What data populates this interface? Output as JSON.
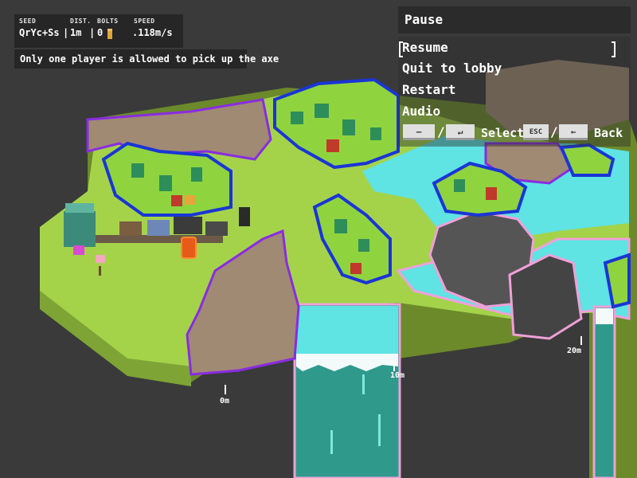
{
  "hud": {
    "seed_caption": "SEED",
    "seed_value": "QrYc+Ss",
    "dist_caption": "DIST.",
    "dist_value": "1m",
    "bolts_caption": "BOLTS",
    "bolts_value": "0",
    "speed_caption": "SPEED",
    "speed_value": ".118m/s"
  },
  "notice": "Only one player is allowed to pick up the axe",
  "pause": {
    "title": "Pause",
    "items": [
      "Resume",
      "Quit to lobby",
      "Restart",
      "Audio"
    ],
    "selected_index": 0,
    "controls": {
      "minus_key": "—",
      "enter_key": "↵",
      "select_label": "Select",
      "esc_key": "ESC",
      "back_key": "←",
      "back_label": "Back",
      "slash": "/"
    }
  },
  "distance_markers": [
    "0m",
    "10m",
    "20m"
  ],
  "colors": {
    "grass": "#a4d34a",
    "water": "#5fe3e3",
    "rock": "#a08a73",
    "dark_rock": "#555555",
    "tree": "#8fd43f",
    "outline_blue": "#1a35d6",
    "outline_purple": "#8a2be2",
    "outline_pink": "#f0a0d8"
  }
}
